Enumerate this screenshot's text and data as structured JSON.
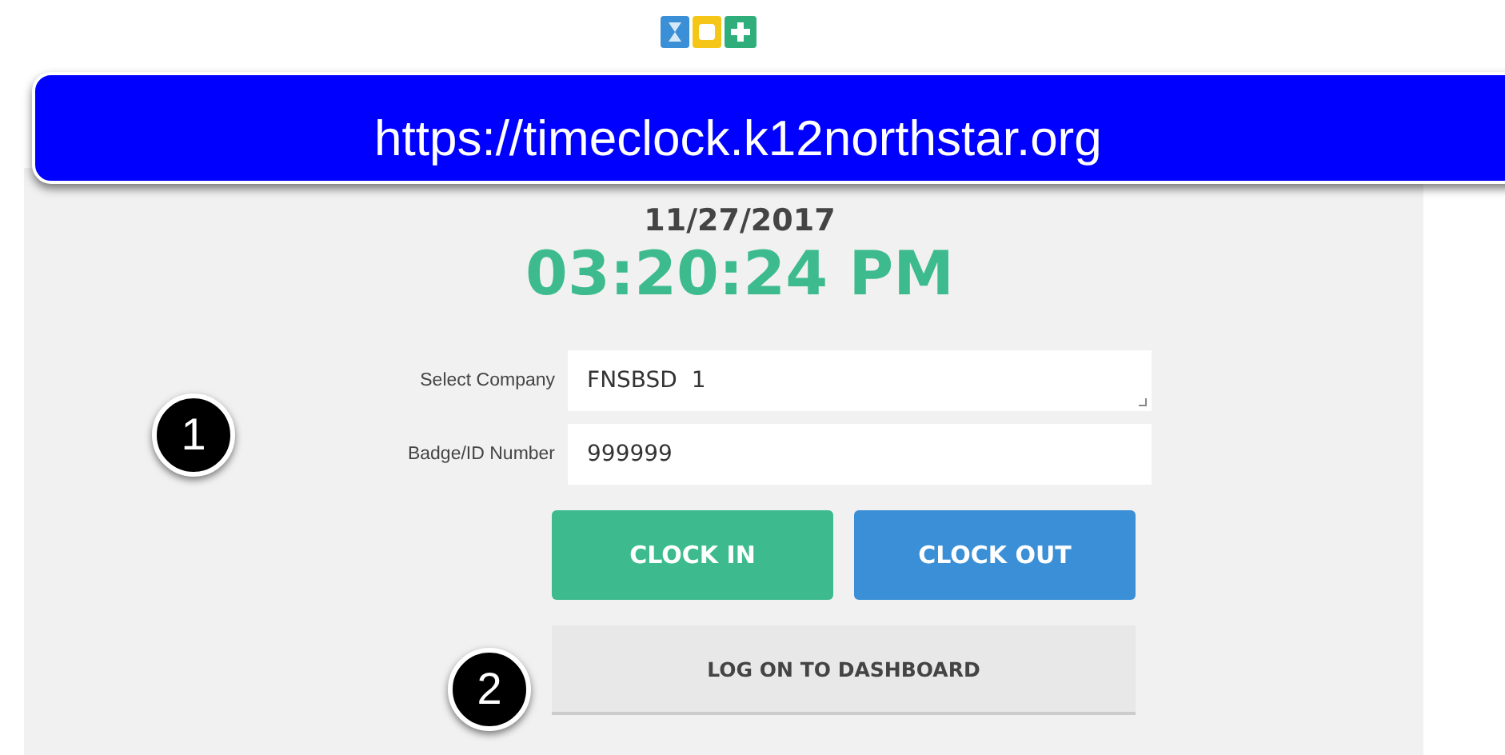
{
  "banner": {
    "url": "https://timeclock.k12northstar.org"
  },
  "clock": {
    "date": "11/27/2017",
    "time": "03:20:24 PM"
  },
  "fields": [
    {
      "label": "Select Company",
      "value": "FNSBSD  1",
      "kind": "select"
    },
    {
      "label": "Badge/ID Number",
      "value": "999999",
      "kind": "text"
    }
  ],
  "buttons": [
    {
      "label": "CLOCK IN",
      "color": "#3dbb8f"
    },
    {
      "label": "CLOCK OUT",
      "color": "#3a8fd6"
    }
  ],
  "dashboard_button": {
    "label": "LOG ON TO DASHBOARD"
  },
  "callouts": [
    {
      "label": "1"
    },
    {
      "label": "2"
    }
  ]
}
